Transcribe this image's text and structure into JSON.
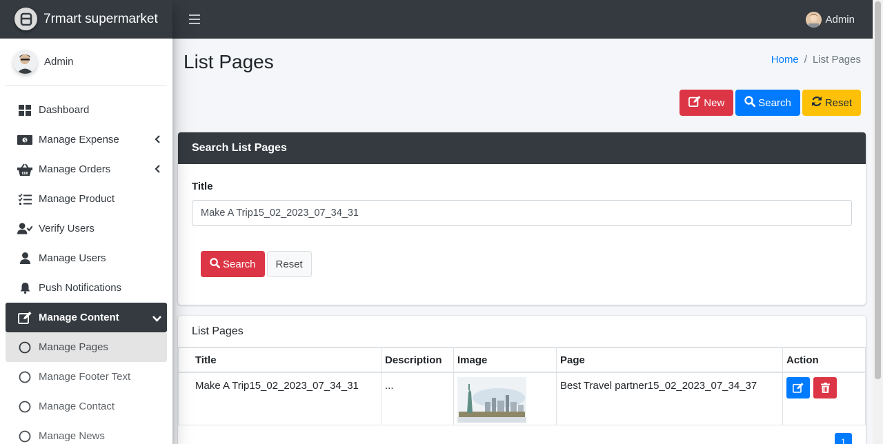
{
  "brand": {
    "name": "7rmart supermarket"
  },
  "sidebar": {
    "user": "Admin",
    "items": [
      {
        "label": "Dashboard",
        "icon": "dashboard-icon"
      },
      {
        "label": "Manage Expense",
        "icon": "money-icon"
      },
      {
        "label": "Manage Orders",
        "icon": "basket-icon"
      },
      {
        "label": "Manage Product",
        "icon": "tasks-icon"
      },
      {
        "label": "Verify Users",
        "icon": "user-check-icon"
      },
      {
        "label": "Manage Users",
        "icon": "user-icon"
      },
      {
        "label": "Push Notifications",
        "icon": "bell-icon"
      },
      {
        "label": "Manage Content",
        "icon": "edit-icon"
      },
      {
        "label": "Manage Pages",
        "icon": "circle-icon"
      },
      {
        "label": "Manage Footer Text",
        "icon": "circle-icon"
      },
      {
        "label": "Manage Contact",
        "icon": "circle-icon"
      },
      {
        "label": "Manage News",
        "icon": "circle-icon"
      }
    ]
  },
  "topbar": {
    "user": "Admin"
  },
  "page": {
    "title": "List Pages",
    "breadcrumb": {
      "home": "Home",
      "separator": "/",
      "current": "List Pages"
    }
  },
  "actions": {
    "new": "New",
    "search": "Search",
    "reset": "Reset"
  },
  "search_card": {
    "title": "Search List Pages",
    "field_label": "Title",
    "field_value": "Make A Trip15_02_2023_07_34_31",
    "search_button": "Search",
    "reset_button": "Reset"
  },
  "list_card": {
    "title": "List Pages",
    "columns": [
      "Title",
      "Description",
      "Image",
      "Page",
      "Action"
    ],
    "rows": [
      {
        "title": "Make A Trip15_02_2023_07_34_31",
        "description": "...",
        "page": "Best Travel partner15_02_2023_07_34_37"
      }
    ],
    "pagination_current": "1"
  },
  "colors": {
    "primary": "#007bff",
    "danger": "#dc3545",
    "warning": "#ffc107",
    "dark": "#343a40"
  }
}
